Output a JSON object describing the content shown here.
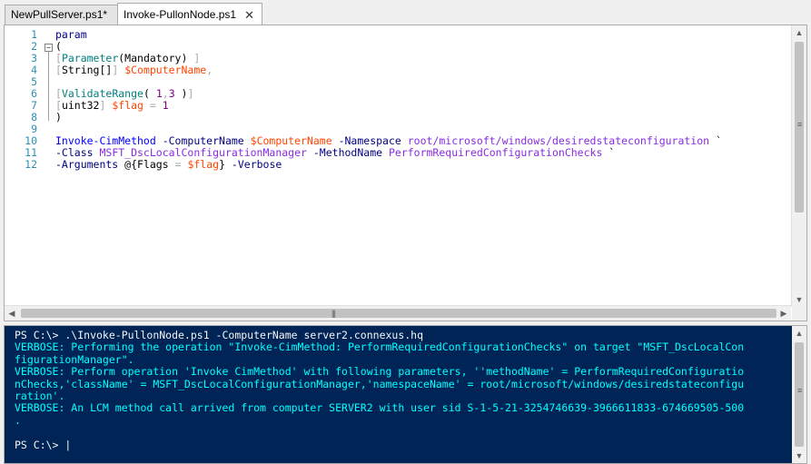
{
  "tabs": [
    {
      "label": "NewPullServer.ps1*",
      "active": false
    },
    {
      "label": "Invoke-PullonNode.ps1",
      "active": true,
      "close_glyph": "✕"
    }
  ],
  "editor": {
    "line_numbers": [
      "1",
      "2",
      "3",
      "4",
      "5",
      "6",
      "7",
      "8",
      "9",
      "10",
      "11",
      "12"
    ],
    "lines": [
      [
        {
          "t": "param",
          "c": "kw"
        }
      ],
      [
        {
          "t": "(",
          "c": "plain"
        }
      ],
      [
        {
          "t": "[",
          "c": "br"
        },
        {
          "t": "Parameter",
          "c": "type"
        },
        {
          "t": "(Mandatory) ",
          "c": "plain"
        },
        {
          "t": "]",
          "c": "br"
        }
      ],
      [
        {
          "t": "[",
          "c": "br"
        },
        {
          "t": "String[]",
          "c": "plain"
        },
        {
          "t": "] ",
          "c": "br"
        },
        {
          "t": "$ComputerName",
          "c": "var"
        },
        {
          "t": ",",
          "c": "op"
        }
      ],
      [],
      [
        {
          "t": "[",
          "c": "br"
        },
        {
          "t": "ValidateRange",
          "c": "type"
        },
        {
          "t": "( ",
          "c": "plain"
        },
        {
          "t": "1",
          "c": "num"
        },
        {
          "t": ",",
          "c": "op"
        },
        {
          "t": "3",
          "c": "num"
        },
        {
          "t": " )",
          "c": "plain"
        },
        {
          "t": "]",
          "c": "br"
        }
      ],
      [
        {
          "t": "[",
          "c": "br"
        },
        {
          "t": "uint32",
          "c": "plain"
        },
        {
          "t": "] ",
          "c": "br"
        },
        {
          "t": "$flag",
          "c": "var"
        },
        {
          "t": " = ",
          "c": "op"
        },
        {
          "t": "1",
          "c": "num"
        }
      ],
      [
        {
          "t": ")",
          "c": "plain"
        }
      ],
      [],
      [
        {
          "t": "Invoke-CimMethod",
          "c": "cmd"
        },
        {
          "t": " -ComputerName ",
          "c": "param"
        },
        {
          "t": "$ComputerName",
          "c": "var"
        },
        {
          "t": " -Namespace ",
          "c": "param"
        },
        {
          "t": "root/microsoft/windows/desiredstateconfiguration",
          "c": "str"
        },
        {
          "t": " `",
          "c": "plain"
        }
      ],
      [
        {
          "t": "-Class ",
          "c": "param"
        },
        {
          "t": "MSFT_DscLocalConfigurationManager",
          "c": "str"
        },
        {
          "t": " -MethodName ",
          "c": "param"
        },
        {
          "t": "PerformRequiredConfigurationChecks",
          "c": "str"
        },
        {
          "t": " `",
          "c": "plain"
        }
      ],
      [
        {
          "t": "-Arguments ",
          "c": "param"
        },
        {
          "t": "@{Flags ",
          "c": "plain"
        },
        {
          "t": "=",
          "c": "op"
        },
        {
          "t": " ",
          "c": "plain"
        },
        {
          "t": "$flag",
          "c": "var"
        },
        {
          "t": "}",
          "c": "plain"
        },
        {
          "t": " -Verbose",
          "c": "param"
        }
      ]
    ]
  },
  "console": {
    "lines": [
      {
        "text": "PS C:\\> .\\Invoke-PullonNode.ps1 -ComputerName server2.connexus.hq",
        "kind": "white"
      },
      {
        "text": "VERBOSE: Performing the operation \"Invoke-CimMethod: PerformRequiredConfigurationChecks\" on target \"MSFT_DscLocalCon",
        "kind": "verbose"
      },
      {
        "text": "figurationManager\".",
        "kind": "verbose"
      },
      {
        "text": "VERBOSE: Perform operation 'Invoke CimMethod' with following parameters, ''methodName' = PerformRequiredConfiguratio",
        "kind": "verbose"
      },
      {
        "text": "nChecks,'className' = MSFT_DscLocalConfigurationManager,'namespaceName' = root/microsoft/windows/desiredstateconfigu",
        "kind": "verbose"
      },
      {
        "text": "ration'.",
        "kind": "verbose"
      },
      {
        "text": "VERBOSE: An LCM method call arrived from computer SERVER2 with user sid S-1-5-21-3254746639-3966611833-674669505-500",
        "kind": "verbose"
      },
      {
        "text": ".",
        "kind": "verbose"
      },
      {
        "text": "",
        "kind": "white"
      },
      {
        "text": "PS C:\\> |",
        "kind": "white"
      }
    ]
  },
  "colors": {
    "console_bg": "#012456",
    "verbose": "#00ffff",
    "prompt": "#f5f5f5",
    "line_number": "#2b91af"
  }
}
